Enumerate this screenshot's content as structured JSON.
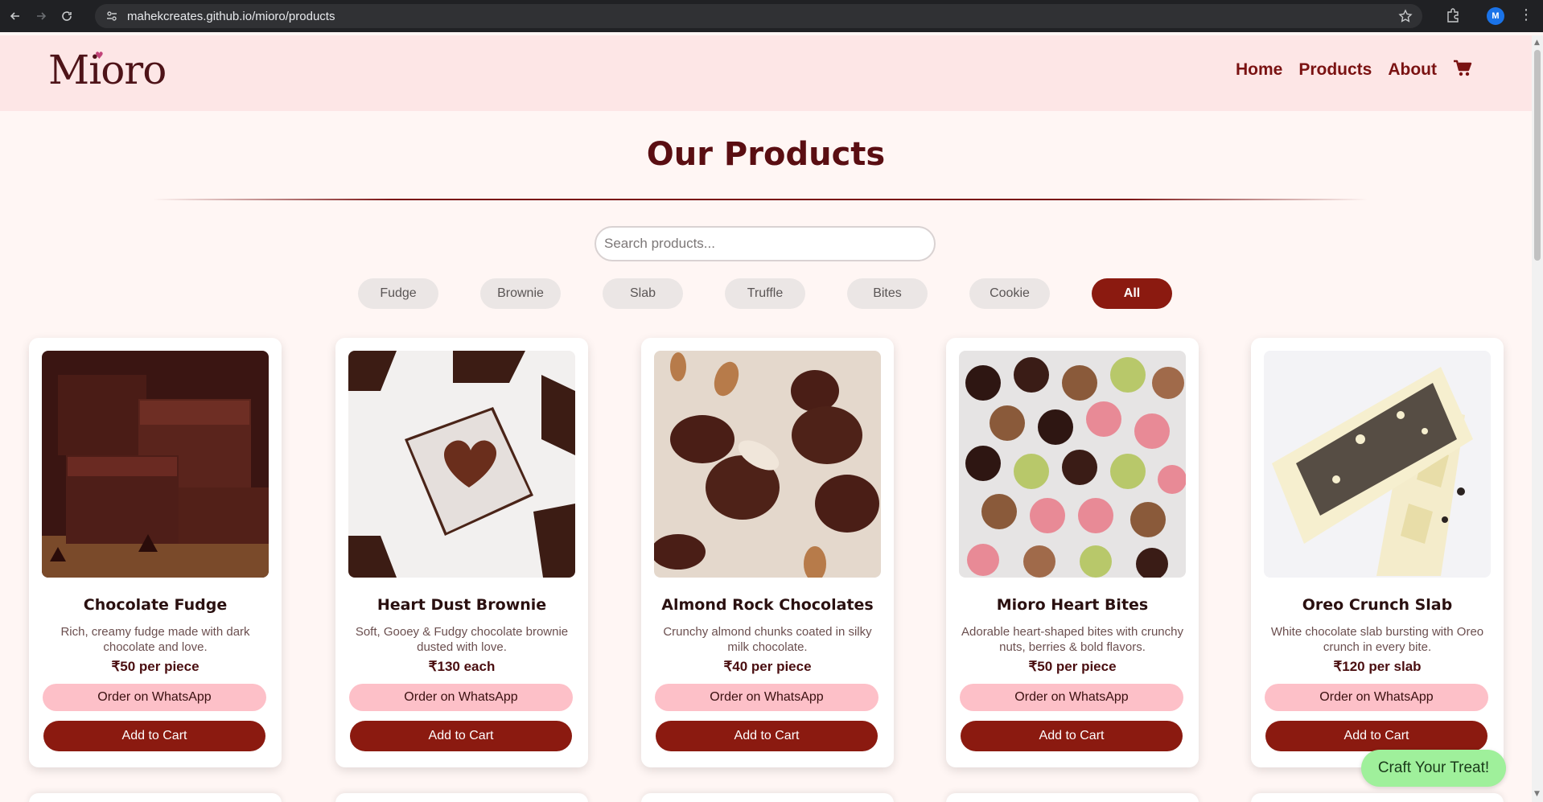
{
  "browser": {
    "url": "mahekcreates.github.io/mioro/products",
    "avatar_letter": "M"
  },
  "header": {
    "logo": "Mioro",
    "nav": [
      "Home",
      "Products",
      "About"
    ]
  },
  "main": {
    "title": "Our Products",
    "search_placeholder": "Search products...",
    "filters": [
      "Fudge",
      "Brownie",
      "Slab",
      "Truffle",
      "Bites",
      "Cookie",
      "All"
    ],
    "active_filter": "All"
  },
  "products": [
    {
      "name": "Chocolate Fudge",
      "description": "Rich, creamy fudge made with dark chocolate and love.",
      "price": "₹50 per piece",
      "whatsapp_label": "Order on WhatsApp",
      "cart_label": "Add to Cart"
    },
    {
      "name": "Heart Dust Brownie",
      "description": "Soft, Gooey & Fudgy chocolate brownie dusted with love.",
      "price": "₹130 each",
      "whatsapp_label": "Order on WhatsApp",
      "cart_label": "Add to Cart"
    },
    {
      "name": "Almond Rock Chocolates",
      "description": "Crunchy almond chunks coated in silky milk chocolate.",
      "price": "₹40 per piece",
      "whatsapp_label": "Order on WhatsApp",
      "cart_label": "Add to Cart"
    },
    {
      "name": "Mioro Heart Bites",
      "description": "Adorable heart-shaped bites with crunchy nuts, berries & bold flavors.",
      "price": "₹50 per piece",
      "whatsapp_label": "Order on WhatsApp",
      "cart_label": "Add to Cart"
    },
    {
      "name": "Oreo Crunch Slab",
      "description": "White chocolate slab bursting with Oreo crunch in every bite.",
      "price": "₹120 per slab",
      "whatsapp_label": "Order on WhatsApp",
      "cart_label": "Add to Cart"
    }
  ],
  "floating_button": "Craft Your Treat!",
  "colors": {
    "accent": "#8b1a10",
    "header_bg": "#fde6e6",
    "whatsapp_bg": "#fdc0c8",
    "craft_bg": "#9ff09b"
  }
}
